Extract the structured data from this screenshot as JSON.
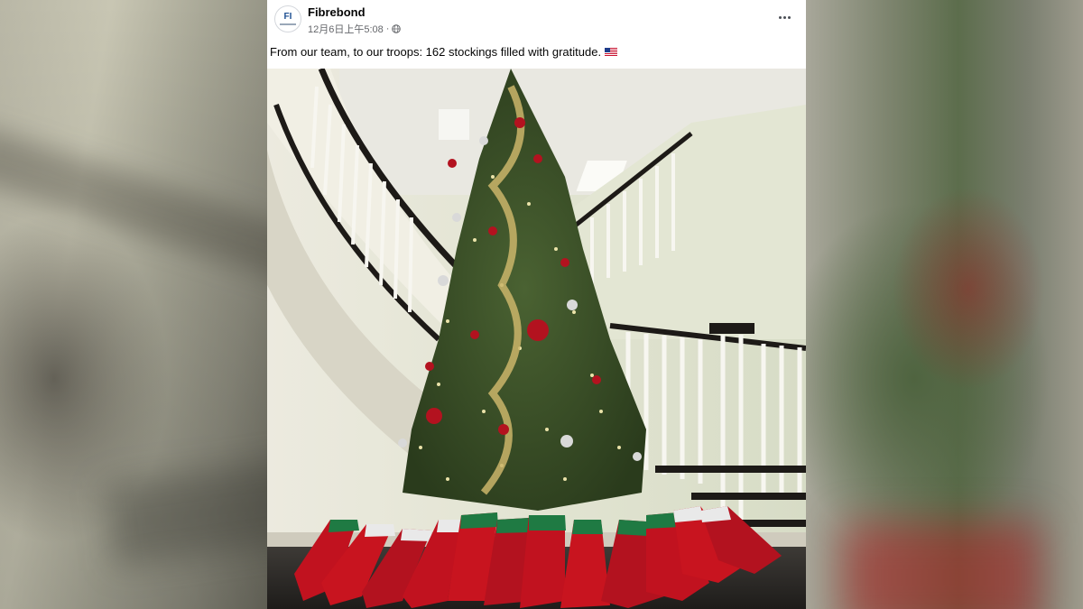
{
  "post": {
    "page_name": "Fibrebond",
    "timestamp": "12月6日上午5:08",
    "separator": "·",
    "privacy_icon": "globe-icon",
    "more_icon": "more-options-icon",
    "avatar_logo_text": "FI",
    "caption": "From our team, to our troops: 162 stockings filled with gratitude.",
    "caption_emoji_icon": "us-flag-icon"
  },
  "photo": {
    "alt_subject": "christmas-tree-with-stockings"
  },
  "colors": {
    "page_name": "#050505",
    "meta_text": "#65676b",
    "brand_blue": "#1d4f91"
  }
}
